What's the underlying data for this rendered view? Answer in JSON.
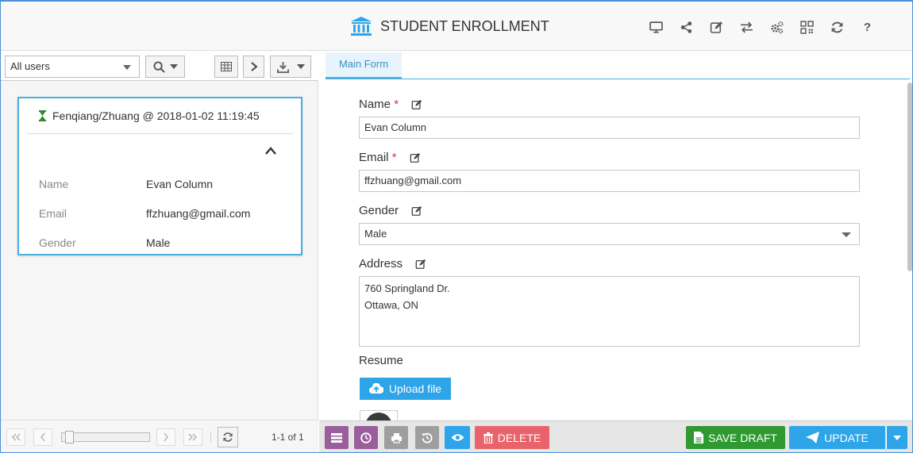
{
  "app": {
    "title": "STUDENT ENROLLMENT"
  },
  "header_icons": [
    "desktop-icon",
    "share-icon",
    "edit-icon",
    "exchange-icon",
    "cogs-icon",
    "qrcode-icon",
    "refresh-icon",
    "question-icon"
  ],
  "header_help": "?",
  "left": {
    "filter_select": "All users",
    "card": {
      "title": "Fenqiang/Zhuang @ 2018-01-02 11:19:45",
      "rows": [
        {
          "key": "Name",
          "value": "Evan Column"
        },
        {
          "key": "Email",
          "value": "ffzhuang@gmail.com"
        },
        {
          "key": "Gender",
          "value": "Male"
        }
      ]
    },
    "page_info": "1-1 of 1"
  },
  "form": {
    "tab": "Main Form",
    "fields": {
      "name": {
        "label": "Name",
        "value": "Evan Column",
        "required": true
      },
      "email": {
        "label": "Email",
        "value": "ffzhuang@gmail.com",
        "required": true
      },
      "gender": {
        "label": "Gender",
        "value": "Male"
      },
      "address": {
        "label": "Address",
        "value": "760 Springland Dr.\nOttawa, ON"
      },
      "resume": {
        "label": "Resume"
      }
    },
    "required_mark": "*",
    "upload_label": "Upload file"
  },
  "actions": {
    "delete": "DELETE",
    "save_draft": "SAVE DRAFT",
    "update": "UPDATE"
  },
  "colors": {
    "accent": "#2da5e8",
    "purple": "#9a5f9a",
    "gray": "#9e9e9e",
    "cyan": "#2da5e8",
    "danger": "#e8636b",
    "success": "#2f9a2f",
    "primary": "#2da5e8"
  }
}
